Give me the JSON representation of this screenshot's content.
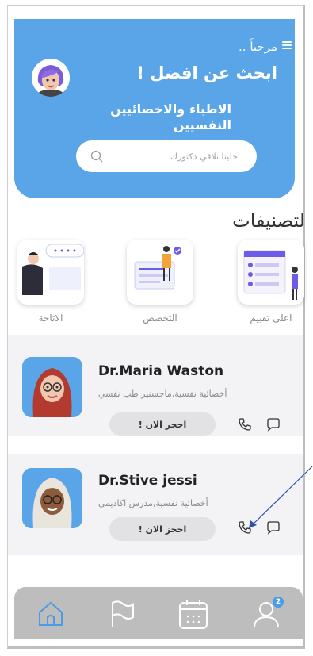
{
  "header": {
    "greeting": "مرحباً ..",
    "headline": "ابحث عن افضل !",
    "subtitle": "الاطباء والاخصائيين النفسيين",
    "search_placeholder": "خلينا نلاقي دكتورك"
  },
  "categories": {
    "title": "لتصنيفات",
    "items": [
      {
        "label": "اعلى تقييم",
        "icon": "rating-illustration-icon"
      },
      {
        "label": "التخصص",
        "icon": "specialty-illustration-icon"
      },
      {
        "label": "الاتاحة",
        "icon": "availability-illustration-icon"
      }
    ]
  },
  "doctors": [
    {
      "name": "Dr.Maria Waston",
      "specialty": "أخصائية نفسية,ماجستير طب نفسي",
      "book_label": "احجز الان !"
    },
    {
      "name": "Dr.Stive jessi",
      "specialty": "أخصائية نفسية,مدرس اكاديمي",
      "book_label": "احجز الان !"
    }
  ],
  "nav": {
    "notification_count": "2",
    "items": [
      "home-icon",
      "flag-icon",
      "calendar-icon",
      "profile-icon"
    ]
  },
  "colors": {
    "accent": "#5aa4e8",
    "nav_bg": "#bdbdbd",
    "card_bg": "#f3f3f5"
  }
}
